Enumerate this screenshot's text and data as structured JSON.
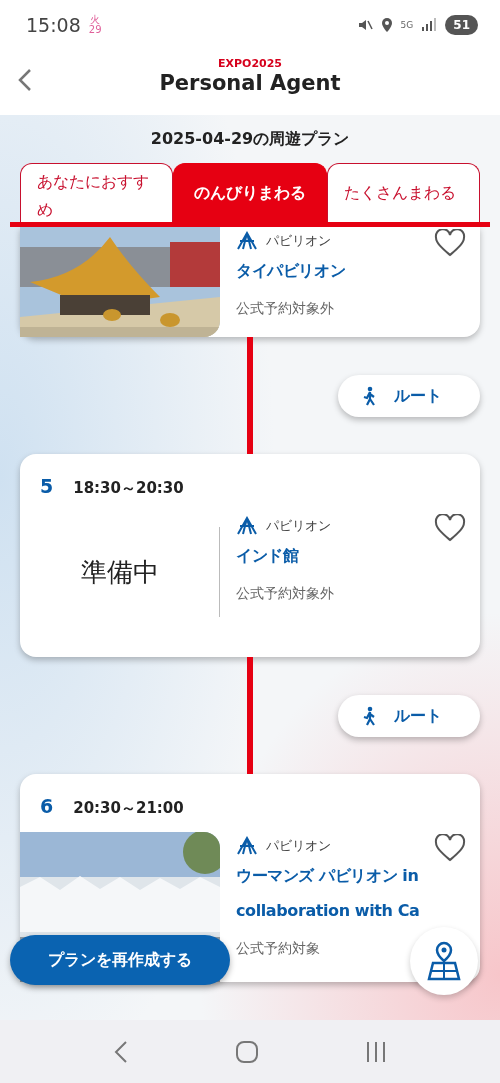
{
  "status_bar": {
    "time": "15:08",
    "weekday": "火",
    "day": "29",
    "network": "5G",
    "battery": "51"
  },
  "header": {
    "brand": "EXPO2025",
    "title": "Personal Agent"
  },
  "plan_title": "2025-04-29の周遊プラン",
  "tabs": [
    {
      "label": "あなたにおすすめ",
      "selected": false
    },
    {
      "label": "のんびりまわる",
      "selected": true
    },
    {
      "label": "たくさんまわる",
      "selected": false
    }
  ],
  "items": [
    {
      "kind": "stop",
      "category": "パビリオン",
      "name": "タイパビリオン",
      "reservation": "公式予約対象外",
      "favorite": false
    },
    {
      "kind": "route",
      "label": "ルート"
    },
    {
      "kind": "stop",
      "number": "5",
      "time": "18:30～20:30",
      "media": {
        "kind": "status"
      },
      "status": "準備中",
      "category": "パビリオン",
      "name": "インド館",
      "reservation": "公式予約対象外",
      "favorite": false
    },
    {
      "kind": "route",
      "label": "ルート"
    },
    {
      "kind": "stop",
      "number": "6",
      "time": "20:30～21:00",
      "category": "パビリオン",
      "name": "ウーマンズ パビリオン in collaboration with Ca",
      "reservation": "公式予約対象",
      "favorite": false
    }
  ],
  "rebuild_button": "プランを再作成する"
}
